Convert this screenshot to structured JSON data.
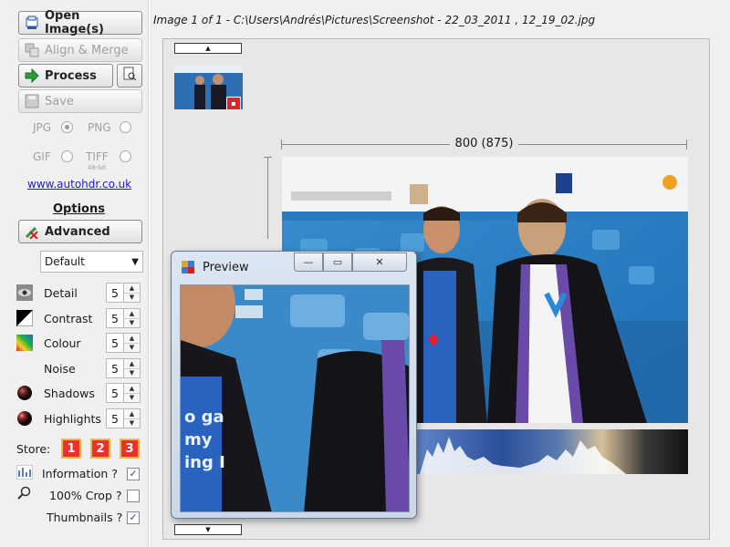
{
  "toolbar": {
    "open_label": "Open Image(s)",
    "align_label": "Align & Merge",
    "process_label": "Process",
    "save_label": "Save"
  },
  "formats": {
    "jpg": "JPG",
    "png": "PNG",
    "gif": "GIF",
    "tiff": "TIFF",
    "tiff_sub": "48-bit",
    "selected": "JPG"
  },
  "link": "www.autohdr.co.uk",
  "options": {
    "heading": "Options",
    "advanced_label": "Advanced",
    "preset": "Default"
  },
  "params": [
    {
      "label": "Detail",
      "value": "5",
      "icon": "eye-icon"
    },
    {
      "label": "Contrast",
      "value": "5",
      "icon": "contrast-icon"
    },
    {
      "label": "Colour",
      "value": "5",
      "icon": "colour-icon"
    },
    {
      "label": "Noise",
      "value": "5",
      "icon": ""
    },
    {
      "label": "Shadows",
      "value": "5",
      "icon": "shadow-ball-icon"
    },
    {
      "label": "Highlights",
      "value": "5",
      "icon": "highlight-ball-icon"
    }
  ],
  "store": {
    "label": "Store:",
    "slots": [
      "1",
      "2",
      "3"
    ]
  },
  "checks": {
    "information": {
      "label": "Information ?",
      "checked": true
    },
    "crop": {
      "label": "100% Crop ?",
      "checked": false
    },
    "thumbnails": {
      "label": "Thumbnails ?",
      "checked": true
    }
  },
  "main": {
    "path": "Image 1 of 1 - C:\\Users\\Andrés\\Pictures\\Screenshot - 22_03_2011 , 12_19_02.jpg",
    "dimension": "800 (875)"
  },
  "preview": {
    "title": "Preview",
    "min_glyph": "—",
    "max_glyph": "▭",
    "close_glyph": "✕"
  },
  "colors": {
    "store_red": "#e8322b",
    "link_blue": "#1a1acc",
    "backdrop_blue": "#2f86c8"
  }
}
